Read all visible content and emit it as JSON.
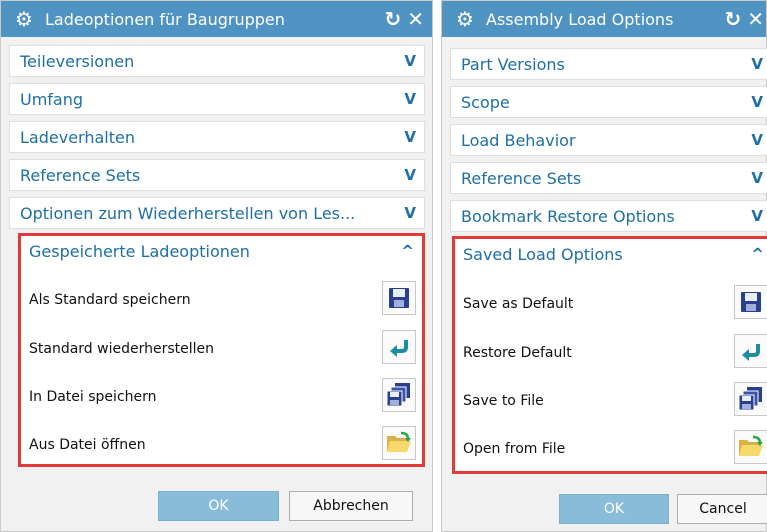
{
  "dialogs": [
    {
      "title": "Ladeoptionen für Baugruppen",
      "sections": [
        "Teileversionen",
        "Umfang",
        "Ladeverhalten",
        "Reference Sets",
        "Optionen zum Wiederherstellen von Les..."
      ],
      "saved_title": "Gespeicherte Ladeoptionen",
      "rows": [
        {
          "label": "Als Standard speichern",
          "icon": "floppy-icon"
        },
        {
          "label": "Standard wiederherstellen",
          "icon": "return-arrow-icon"
        },
        {
          "label": "In Datei speichern",
          "icon": "multi-floppy-icon"
        },
        {
          "label": "Aus Datei öffnen",
          "icon": "folder-open-icon"
        }
      ],
      "ok": "OK",
      "cancel": "Abbrechen"
    },
    {
      "title": "Assembly Load Options",
      "sections": [
        "Part Versions",
        "Scope",
        "Load Behavior",
        "Reference Sets",
        "Bookmark Restore Options"
      ],
      "saved_title": "Saved Load Options",
      "rows": [
        {
          "label": "Save as Default",
          "icon": "floppy-icon"
        },
        {
          "label": "Restore Default",
          "icon": "return-arrow-icon"
        },
        {
          "label": "Save to File",
          "icon": "multi-floppy-icon"
        },
        {
          "label": "Open from File",
          "icon": "folder-open-icon"
        }
      ],
      "ok": "OK",
      "cancel": "Cancel"
    }
  ],
  "colors": {
    "titlebar": "#4f93c2",
    "section_text": "#1d6fa5",
    "highlight": "#e03a3a",
    "ok_button": "#89bcd9"
  }
}
